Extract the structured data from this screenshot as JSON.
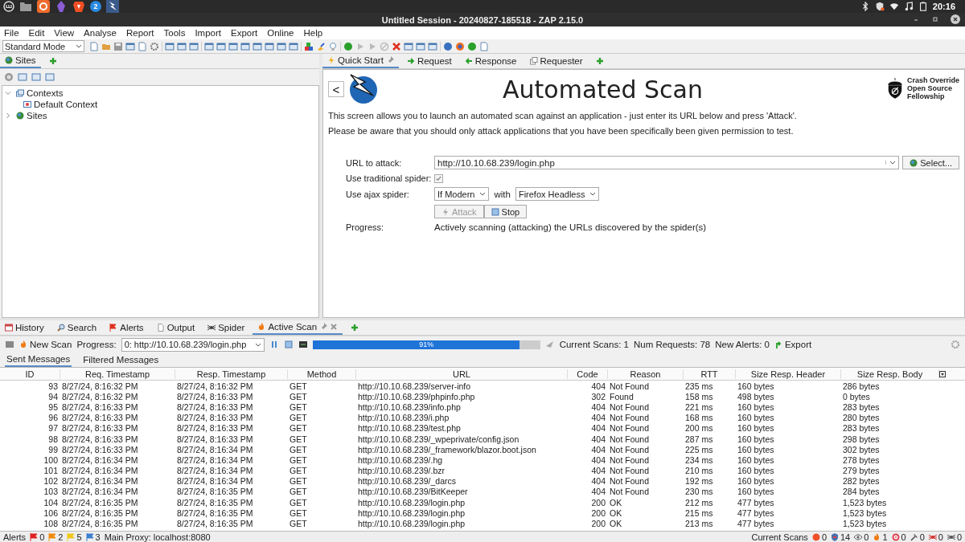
{
  "taskbar": {
    "badge": "2",
    "time": "20:16"
  },
  "window": {
    "title": "Untitled Session - 20240827-185518 - ZAP 2.15.0"
  },
  "menu": [
    "File",
    "Edit",
    "View",
    "Analyse",
    "Report",
    "Tools",
    "Import",
    "Export",
    "Online",
    "Help"
  ],
  "toolbar": {
    "mode": "Standard Mode"
  },
  "left_tabs": [
    {
      "label": "Sites",
      "selected": true
    }
  ],
  "tree": [
    {
      "label": "Contexts",
      "kind": "contexts",
      "expanded": true,
      "children": [
        {
          "label": "Default Context",
          "kind": "context"
        }
      ]
    },
    {
      "label": "Sites",
      "kind": "sites",
      "expanded": false
    }
  ],
  "right_tabs": [
    {
      "label": "Quick Start",
      "kind": "bolt",
      "selected": true,
      "pinned": true
    },
    {
      "label": "Request",
      "kind": "right-arrow",
      "selected": false,
      "pinned": false
    },
    {
      "label": "Response",
      "kind": "left-arrow",
      "selected": false,
      "pinned": false
    },
    {
      "label": "Requester",
      "kind": "pages",
      "selected": false,
      "pinned": false
    }
  ],
  "quick_start": {
    "back": "<",
    "title": "Automated Scan",
    "org": [
      "Crash Override",
      "Open Source",
      "Fellowship"
    ],
    "intro": [
      "This screen allows you to launch an automated scan against  an application - just enter its URL below and press 'Attack'.",
      "Please be aware that you should only attack applications that you have been specifically been given permission to test."
    ],
    "url_label": "URL to attack:",
    "url_value": "http://10.10.68.239/login.php",
    "select": "Select...",
    "traditional_label": "Use traditional spider:",
    "traditional_checked": true,
    "ajax_label": "Use ajax spider:",
    "ajax_mode": "If Modern",
    "with": "with",
    "browser": "Firefox Headless",
    "attack": "Attack",
    "attack_disabled": true,
    "stop": "Stop",
    "progress_label": "Progress:",
    "progress_text": "Actively scanning (attacking) the URLs discovered by the spider(s)"
  },
  "bottom_tabs": [
    {
      "label": "History",
      "kind": "calendar",
      "selected": false
    },
    {
      "label": "Search",
      "kind": "search",
      "selected": false
    },
    {
      "label": "Alerts",
      "kind": "flag",
      "selected": false
    },
    {
      "label": "Output",
      "kind": "page",
      "selected": false
    },
    {
      "label": "Spider",
      "kind": "spider",
      "selected": false
    },
    {
      "label": "Active Scan",
      "kind": "flame",
      "selected": true
    }
  ],
  "scan_toolbar": {
    "new_scan": "New Scan",
    "progress_label": "Progress:",
    "progress_select": "0: http://10.10.68.239/login.php",
    "level": 0.91,
    "percent": "91%",
    "current_scans": "Current Scans: 1",
    "num_requests": "Num Requests: 78",
    "new_alerts": "New Alerts: 0",
    "export": "Export"
  },
  "message_tabs": [
    {
      "label": "Sent Messages",
      "selected": true
    },
    {
      "label": "Filtered Messages",
      "selected": false
    }
  ],
  "table": {
    "columns": [
      "ID",
      "Req. Timestamp",
      "Resp. Timestamp",
      "Method",
      "URL",
      "Code",
      "Reason",
      "RTT",
      "Size Resp. Header",
      "Size Resp. Body"
    ],
    "rows": [
      [
        "93",
        "8/27/24, 8:16:32 PM",
        "8/27/24, 8:16:32 PM",
        "GET",
        "http://10.10.68.239/server-info",
        "404",
        "Not Found",
        "235 ms",
        "160 bytes",
        "286 bytes"
      ],
      [
        "94",
        "8/27/24, 8:16:32 PM",
        "8/27/24, 8:16:33 PM",
        "GET",
        "http://10.10.68.239/phpinfo.php",
        "302",
        "Found",
        "158 ms",
        "498 bytes",
        "0 bytes"
      ],
      [
        "95",
        "8/27/24, 8:16:33 PM",
        "8/27/24, 8:16:33 PM",
        "GET",
        "http://10.10.68.239/info.php",
        "404",
        "Not Found",
        "221 ms",
        "160 bytes",
        "283 bytes"
      ],
      [
        "96",
        "8/27/24, 8:16:33 PM",
        "8/27/24, 8:16:33 PM",
        "GET",
        "http://10.10.68.239/i.php",
        "404",
        "Not Found",
        "168 ms",
        "160 bytes",
        "280 bytes"
      ],
      [
        "97",
        "8/27/24, 8:16:33 PM",
        "8/27/24, 8:16:33 PM",
        "GET",
        "http://10.10.68.239/test.php",
        "404",
        "Not Found",
        "200 ms",
        "160 bytes",
        "283 bytes"
      ],
      [
        "98",
        "8/27/24, 8:16:33 PM",
        "8/27/24, 8:16:33 PM",
        "GET",
        "http://10.10.68.239/_wpeprivate/config.json",
        "404",
        "Not Found",
        "287 ms",
        "160 bytes",
        "298 bytes"
      ],
      [
        "99",
        "8/27/24, 8:16:33 PM",
        "8/27/24, 8:16:34 PM",
        "GET",
        "http://10.10.68.239/_framework/blazor.boot.json",
        "404",
        "Not Found",
        "225 ms",
        "160 bytes",
        "302 bytes"
      ],
      [
        "100",
        "8/27/24, 8:16:34 PM",
        "8/27/24, 8:16:34 PM",
        "GET",
        "http://10.10.68.239/.hg",
        "404",
        "Not Found",
        "234 ms",
        "160 bytes",
        "278 bytes"
      ],
      [
        "101",
        "8/27/24, 8:16:34 PM",
        "8/27/24, 8:16:34 PM",
        "GET",
        "http://10.10.68.239/.bzr",
        "404",
        "Not Found",
        "210 ms",
        "160 bytes",
        "279 bytes"
      ],
      [
        "102",
        "8/27/24, 8:16:34 PM",
        "8/27/24, 8:16:34 PM",
        "GET",
        "http://10.10.68.239/_darcs",
        "404",
        "Not Found",
        "192 ms",
        "160 bytes",
        "282 bytes"
      ],
      [
        "103",
        "8/27/24, 8:16:34 PM",
        "8/27/24, 8:16:35 PM",
        "GET",
        "http://10.10.68.239/BitKeeper",
        "404",
        "Not Found",
        "230 ms",
        "160 bytes",
        "284 bytes"
      ],
      [
        "104",
        "8/27/24, 8:16:35 PM",
        "8/27/24, 8:16:35 PM",
        "GET",
        "http://10.10.68.239/login.php",
        "200",
        "OK",
        "212 ms",
        "477 bytes",
        "1,523 bytes"
      ],
      [
        "106",
        "8/27/24, 8:16:35 PM",
        "8/27/24, 8:16:35 PM",
        "GET",
        "http://10.10.68.239/login.php",
        "200",
        "OK",
        "215 ms",
        "477 bytes",
        "1,523 bytes"
      ],
      [
        "108",
        "8/27/24, 8:16:35 PM",
        "8/27/24, 8:16:35 PM",
        "GET",
        "http://10.10.68.239/login.php",
        "200",
        "OK",
        "213 ms",
        "477 bytes",
        "1,523 bytes"
      ]
    ]
  },
  "status_bar": {
    "alerts_label": "Alerts",
    "alert_counts": [
      {
        "count": "0",
        "color": "#e02020"
      },
      {
        "count": "2",
        "color": "#f08a10"
      },
      {
        "count": "5",
        "color": "#f0c818"
      },
      {
        "count": "3",
        "color": "#3c7fd0"
      }
    ],
    "proxy": "Main Proxy: localhost:8080",
    "scans_label": "Current Scans",
    "scan_counts": [
      {
        "kind": "dot",
        "count": "0"
      },
      {
        "kind": "shield",
        "count": "14"
      },
      {
        "kind": "eye",
        "count": "0"
      },
      {
        "kind": "flame",
        "count": "1"
      },
      {
        "kind": "target",
        "count": "0"
      },
      {
        "kind": "hammer",
        "count": "0"
      },
      {
        "kind": "spider",
        "count": "0"
      },
      {
        "kind": "bug",
        "count": "0"
      }
    ]
  }
}
